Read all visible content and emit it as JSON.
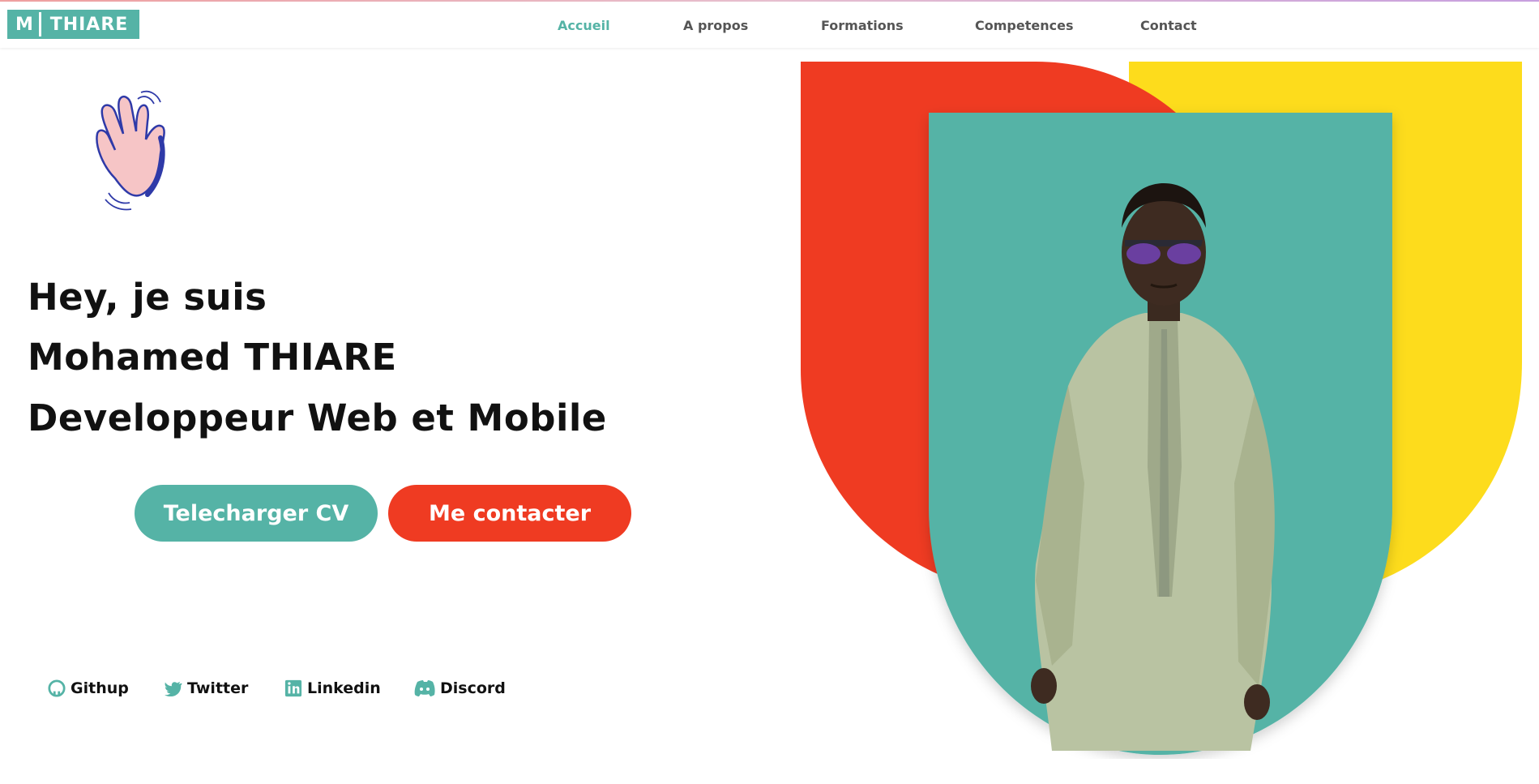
{
  "logo": {
    "initial": "M",
    "name": "THIARE"
  },
  "nav": {
    "items": [
      {
        "label": "Accueil",
        "active": true
      },
      {
        "label": "A propos",
        "active": false
      },
      {
        "label": "Formations",
        "active": false
      },
      {
        "label": "Competences",
        "active": false
      },
      {
        "label": "Contact",
        "active": false
      }
    ]
  },
  "hero": {
    "greeting": "Hey, je suis",
    "first_name": "Mohamed",
    "last_name": "THIARE",
    "role": "Developpeur Web et Mobile",
    "buttons": {
      "cv_label": "Telecharger CV",
      "contact_label": "Me contacter"
    }
  },
  "socials": [
    {
      "label": "Githup",
      "icon": "github-icon"
    },
    {
      "label": "Twitter",
      "icon": "twitter-icon"
    },
    {
      "label": "Linkedin",
      "icon": "linkedin-icon"
    },
    {
      "label": "Discord",
      "icon": "discord-icon"
    }
  ],
  "colors": {
    "accent_teal": "#55b3a6",
    "accent_red": "#ef3b22",
    "accent_yellow": "#fddc1c",
    "hand_pink": "#f6c5c6",
    "hand_outline": "#2f3aa8"
  }
}
